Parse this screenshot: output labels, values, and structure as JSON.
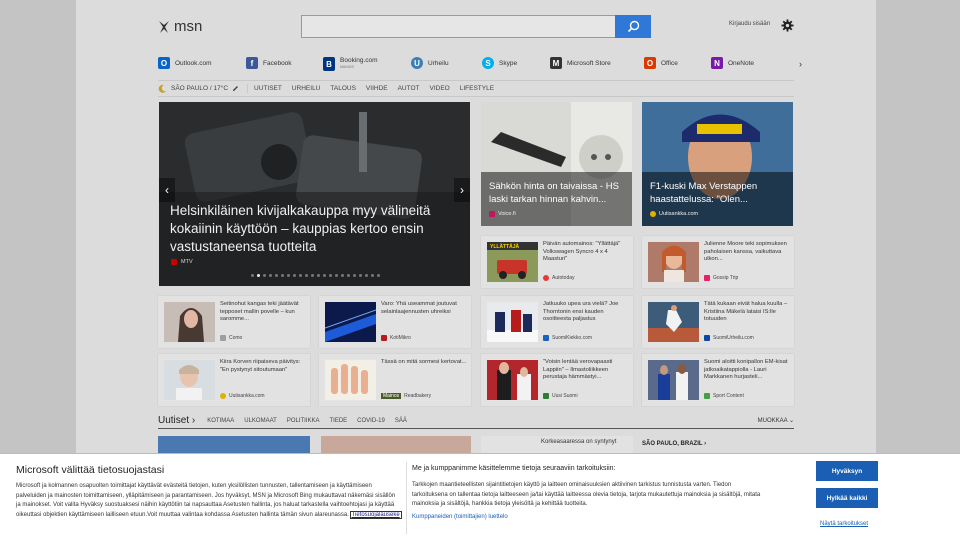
{
  "header": {
    "logo_text": "msn",
    "search_placeholder": "",
    "signin_label": "Kirjaudu sisään"
  },
  "quicklinks": [
    {
      "label": "Outlook.com",
      "color": "#0a64c8",
      "glyph": "O"
    },
    {
      "label": "Facebook",
      "color": "#3b5998",
      "glyph": "f"
    },
    {
      "label": "Booking.com",
      "sublabel": "MAINOS",
      "color": "#003580",
      "glyph": "B"
    },
    {
      "label": "Urheilu",
      "color": "#3c7fb8",
      "glyph": "U"
    },
    {
      "label": "Skype",
      "color": "#00aff0",
      "glyph": "S"
    },
    {
      "label": "Microsoft Store",
      "color": "#333333",
      "glyph": "M"
    },
    {
      "label": "Office",
      "color": "#d83b01",
      "glyph": "O"
    },
    {
      "label": "OneNote",
      "color": "#7719aa",
      "glyph": "N"
    }
  ],
  "nav": {
    "weather": "SÃO PAULO / 17°C",
    "links": [
      "UUTISET",
      "URHEILU",
      "TALOUS",
      "VIIHDE",
      "AUTOT",
      "VIDEO",
      "LIFESTYLE"
    ]
  },
  "hero": {
    "title": "Helsinkiläinen kivijalkakauppa myy välineitä kokaiinin käyttöön – kauppias kertoo ensin vastustaneensa tuotteita",
    "source": "MTV"
  },
  "big_cards": [
    {
      "title": "Sähkön hinta on taivaissa - HS laski tarkan hinnan kahvin...",
      "source": "Voice.fi"
    },
    {
      "title": "F1-kuski Max Verstappen haastattelussa: \"Olen...",
      "source": "Uutisankka.com"
    }
  ],
  "cards": [
    {
      "title": "Päivän automainos: \"Yllättäjä\" Volkswagen Syncro 4 x 4 Maasturi\"",
      "source": "Autotoday",
      "ad": false
    },
    {
      "title": "Julienne Moore teki sopimuksen paholaisen kanssa, vaikuttava ulkon...",
      "source": "Gossip Trip",
      "ad": false
    },
    {
      "title": "Seitinohut kangas teki jäätävät tepposet mallin povelle – kun saromme...",
      "source": "Como",
      "ad": false
    },
    {
      "title": "Varo: Yhä useammat joutuvat selainlaajennusten uhreiksi",
      "source": "KotiMikro",
      "ad": false
    },
    {
      "title": "Jatkuuko upea ura vielä? Joe Thorntonin ensi kauden osoitteesta paljastus",
      "source": "SuomiKiekko.com",
      "ad": false
    },
    {
      "title": "Tätä kukaan eivät halua kuulla – Kristiina Mäkelä lataisi IS:lle totuuden",
      "source": "SuomiUrheilu.com",
      "ad": false
    },
    {
      "title": "Kiira Korven riipaiseva päivitys: \"En pystynyt sitoutumaan\"",
      "source": "Uutisankka.com",
      "ad": false
    },
    {
      "title": "Tässä on mitä sormesi kertovat...",
      "source": "Readbakery",
      "ad": true,
      "ad_label": "Mainos"
    },
    {
      "title": "\"Voisin lentää verovapaasti Lappiin\" – Ilmastoliikkeen perustaja hämmästyi...",
      "source": "Uusi Suomi",
      "ad": false
    },
    {
      "title": "Suomi aloitti konipallon EM-kisat jatkoaikatappiolla - Lauri Markkanen hurjasteli...",
      "source": "Sport Content",
      "ad": false
    }
  ],
  "news_section": {
    "title": "Uutiset",
    "links": [
      "KOTIMAA",
      "ULKOMAAT",
      "POLITIIKKA",
      "TIEDE",
      "COVID-19",
      "SÄÄ"
    ],
    "edit_label": "MUOKKAA",
    "peek_title": "Korkeasaaressa on syntynyt",
    "peek_weather": "SÃO PAULO, BRAZIL"
  },
  "consent": {
    "title": "Microsoft välittää tietosuojastasi",
    "body": "Microsoft ja kolmannen osapuolten toimittajat käyttävät evästeitä tietojen, kuten yksilöllisten tunnusten, tallentamiseen ja käyttämiseen palveluiden ja mainosten toimittamiseen, ylläpitämiseen ja parantamiseen. Jos hyväksyt, MSN ja Microsoft Bing mukauttavat näkemäsi sisällön ja mainokset. Voit valita Hyväksy suostuaksesi näihin käyttötiin tai napsauttaa Asetusten hallinta, jos haluat tarkastella vaihtoehtojasi ja käyttää oikeuttasi objektien käyttämiseen lailliseen etuun.Voit muuttaa valintaa kohdassa Asetusten hallinta tämän sivun alareunassa.",
    "privacy_link": "Tietosuojalauseke",
    "right_title": "Me ja kumppanimme käsittelemme tietoja seuraaviin tarkoituksiin:",
    "right_body": "Tarkkojen maantieteellisten sijaintitietojen käyttö ja laitteen ominaisuuksien aktiivinen tarkistus tunnistusta varten. Tiedon tarkoituksena on tallentaa tietoja laitteeseen ja/tai käyttää laitteessa olevia tietoja, tarjota mukautettuja mainoksia ja sisältöjä, mitata mainoksia ja sisältöjä, hankkia tietoja yleisöltä ja kehittää tuotteita.",
    "partners_link": "Kumppaneiden (toimittajien) luettelo",
    "accept_label": "Hyväksyn",
    "reject_label": "Hylkää kaikki",
    "purposes_label": "Näytä tarkoitukset"
  }
}
